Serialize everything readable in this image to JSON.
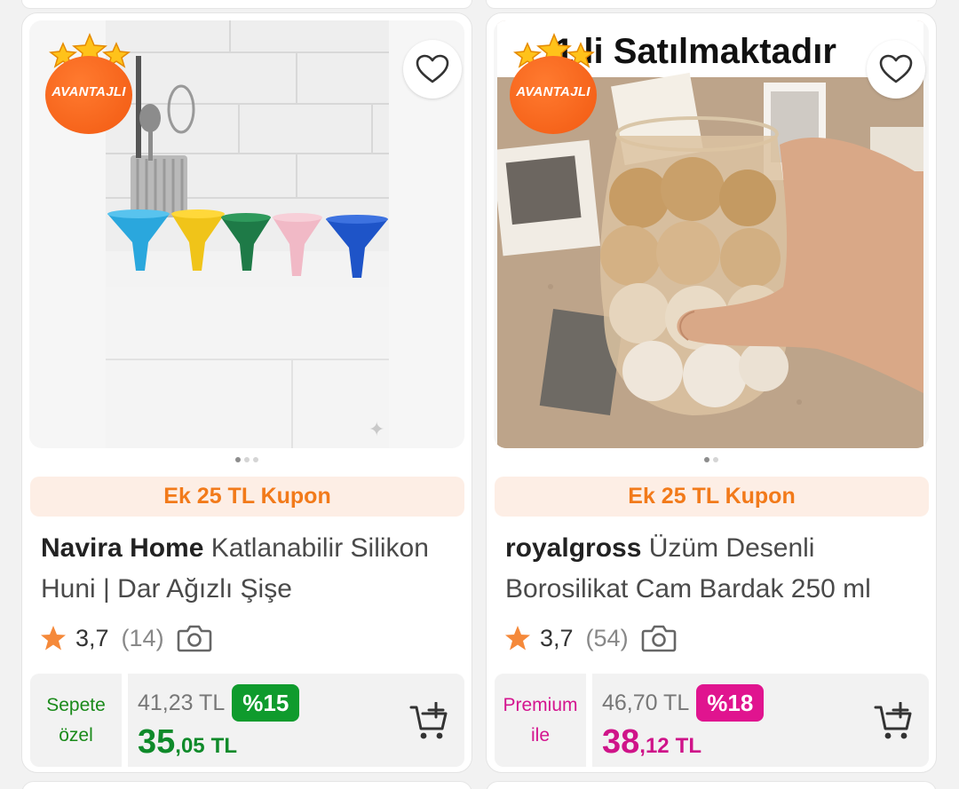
{
  "products": [
    {
      "badge": "AVANTAJLI",
      "favorite_icon": "heart-outline-icon",
      "slide_count": 3,
      "active_slide": 0,
      "coupon": "Ek 25 TL Kupon",
      "brand": "Navira Home",
      "name": "Katlanabilir Silikon Huni | Dar Ağızlı Şişe",
      "rating": "3,7",
      "rating_stars": 3.7,
      "review_count": "(14)",
      "price_label_line1": "Sepete",
      "price_label_line2": "özel",
      "price_label_color": "#1a8a1a",
      "old_price": "41,23 TL",
      "discount": "%15",
      "discount_color": "#0f9b2d",
      "new_price_main": "35",
      "new_price_decimal": ",05",
      "currency": "TL",
      "new_price_color": "#0f8a2a"
    },
    {
      "badge": "AVANTAJLI",
      "image_caption": "1 li Satılmaktadır",
      "favorite_icon": "heart-outline-icon",
      "slide_count": 2,
      "active_slide": 0,
      "coupon": "Ek 25 TL Kupon",
      "brand": "royalgross",
      "name": "Üzüm Desenli Borosilikat Cam Bardak 250 ml",
      "rating": "3,7",
      "rating_stars": 3.7,
      "review_count": "(54)",
      "price_label_line1": "Premium",
      "price_label_line2": "ile",
      "price_label_color": "#d4148f",
      "old_price": "46,70 TL",
      "discount": "%18",
      "discount_color": "#e0148f",
      "new_price_main": "38",
      "new_price_decimal": ",12",
      "currency": "TL",
      "new_price_color": "#cf1489"
    }
  ],
  "colors": {
    "accent_orange": "#f27a1a",
    "coupon_bg": "#fdeee5",
    "star": "#f5893a"
  }
}
